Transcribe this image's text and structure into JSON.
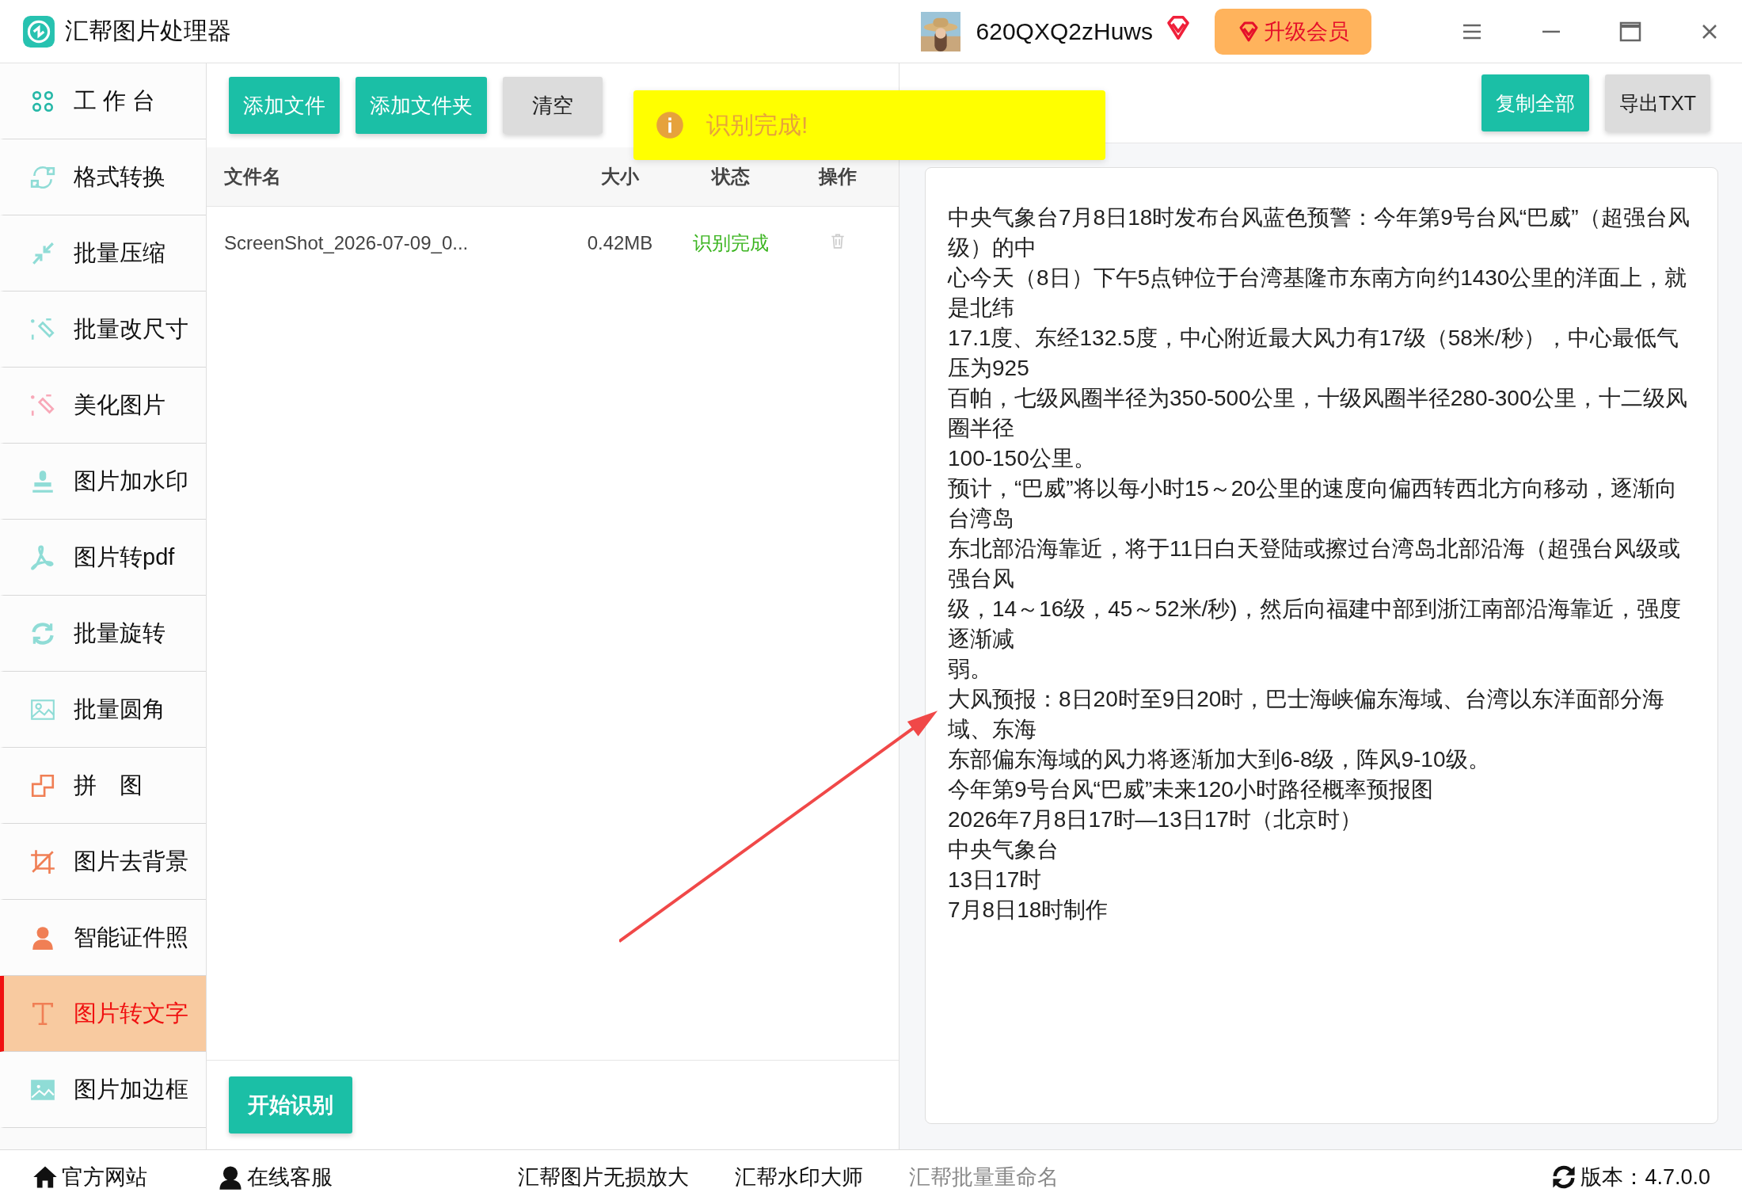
{
  "app": {
    "title": "汇帮图片处理器",
    "user": "620QXQ2zHuws",
    "upgrade": "升级会员"
  },
  "sidebar": {
    "items": [
      {
        "label": "工 作 台",
        "selected": false
      },
      {
        "label": "格式转换",
        "selected": false
      },
      {
        "label": "批量压缩",
        "selected": false
      },
      {
        "label": "批量改尺寸",
        "selected": false
      },
      {
        "label": "美化图片",
        "selected": false
      },
      {
        "label": "图片加水印",
        "selected": false
      },
      {
        "label": "图片转pdf",
        "selected": false
      },
      {
        "label": "批量旋转",
        "selected": false
      },
      {
        "label": "批量圆角",
        "selected": false
      },
      {
        "label": "拼　图",
        "selected": false
      },
      {
        "label": "图片去背景",
        "selected": false
      },
      {
        "label": "智能证件照",
        "selected": false
      },
      {
        "label": "图片转文字",
        "selected": true
      },
      {
        "label": "图片加边框",
        "selected": false
      }
    ]
  },
  "toolbar": {
    "buttons": [
      {
        "label": "添加文件",
        "kind": "primary"
      },
      {
        "label": "添加文件夹",
        "kind": "primary"
      },
      {
        "label": "清空",
        "kind": "plain"
      }
    ]
  },
  "table": {
    "columns": [
      "文件名",
      "大小",
      "状态",
      "操作"
    ],
    "rows": [
      {
        "file": "ScreenShot_2026-07-09_0...",
        "size": "0.42MB",
        "status": "识别完成"
      }
    ]
  },
  "start_button": "开始识别",
  "toast": {
    "text": "识别完成!"
  },
  "result": {
    "buttons": [
      {
        "label": "复制全部",
        "kind": "primary"
      },
      {
        "label": "导出TXT",
        "kind": "plain"
      }
    ],
    "lines": [
      "中央气象台7月8日18时发布台风蓝色预警：今年第9号台风“巴威”（超强台风级）的中",
      "心今天（8日）下午5点钟位于台湾基隆市东南方向约1430公里的洋面上，就是北纬",
      "17.1度、东经132.5度，中心附近最大风力有17级（58米/秒），中心最低气压为925",
      "百帕，七级风圈半径为350-500公里，十级风圈半径280-300公里，十二级风圈半径",
      "100-150公里。",
      "预计，“巴威”将以每小时15～20公里的速度向偏西转西北方向移动，逐渐向台湾岛",
      "东北部沿海靠近，将于11日白天登陆或擦过台湾岛北部沿海（超强台风级或强台风",
      "级，14～16级，45～52米/秒)，然后向福建中部到浙江南部沿海靠近，强度逐渐减",
      "弱。",
      "大风预报：8日20时至9日20时，巴士海峡偏东海域、台湾以东洋面部分海域、东海",
      "东部偏东海域的风力将逐渐加大到6-8级，阵风9-10级。",
      "今年第9号台风“巴威”未来120小时路径概率预报图",
      "2026年7月8日17时—13日17时（北京时）",
      "中央气象台",
      "13日17时",
      "7月8日18时制作"
    ]
  },
  "footer": {
    "left": [
      "官方网站",
      "在线客服"
    ],
    "center": [
      {
        "label": "汇帮图片无损放大",
        "muted": false
      },
      {
        "label": "汇帮水印大师",
        "muted": false
      },
      {
        "label": "汇帮批量重命名",
        "muted": true
      }
    ],
    "version": "版本：4.7.0.0"
  }
}
